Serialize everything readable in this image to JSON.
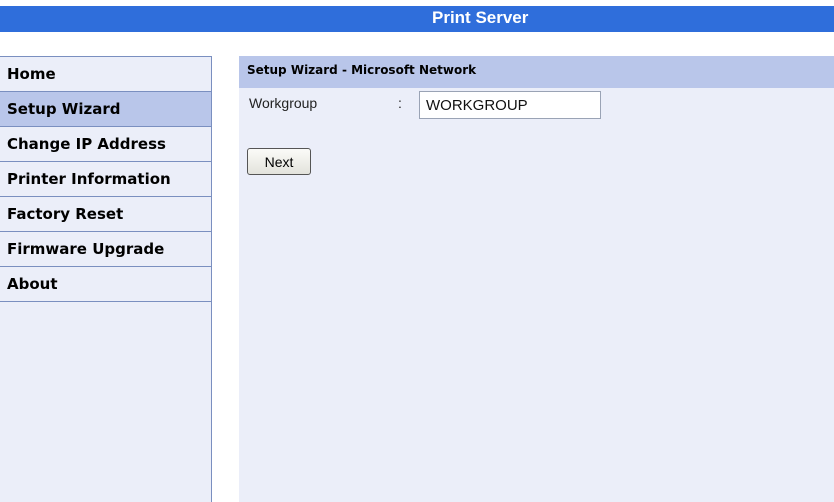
{
  "header": {
    "title": "Print Server"
  },
  "sidebar": {
    "items": [
      {
        "label": "Home"
      },
      {
        "label": "Setup Wizard",
        "active": true
      },
      {
        "label": "Change IP Address"
      },
      {
        "label": "Printer Information"
      },
      {
        "label": "Factory Reset"
      },
      {
        "label": "Firmware Upgrade"
      },
      {
        "label": "About"
      }
    ]
  },
  "main": {
    "title": "Setup Wizard - Microsoft Network",
    "workgroup": {
      "label": "Workgroup",
      "separator": ":",
      "value": "WORKGROUP"
    },
    "next_label": "Next"
  },
  "colors": {
    "header_bg": "#2f6edb",
    "panel_bg": "#ebeef9",
    "active_bg": "#b9c6ea",
    "border": "#7a8fc0"
  }
}
